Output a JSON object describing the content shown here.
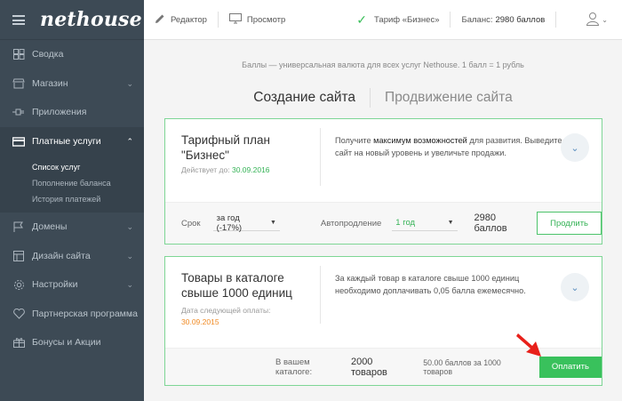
{
  "logo": "nethouse",
  "sidebar": {
    "items": [
      {
        "label": "Сводка",
        "icon": "squares-icon",
        "chevron": ""
      },
      {
        "label": "Магазин",
        "icon": "store-icon",
        "chevron": "⌄"
      },
      {
        "label": "Приложения",
        "icon": "plug-icon",
        "chevron": ""
      },
      {
        "label": "Платные услуги",
        "icon": "card-icon",
        "chevron": "⌃"
      }
    ],
    "sub_items": [
      "Список услуг",
      "Пополнение баланса",
      "История платежей"
    ],
    "items2": [
      {
        "label": "Домены",
        "icon": "flag-icon",
        "chevron": "⌄"
      },
      {
        "label": "Дизайн сайта",
        "icon": "layout-icon",
        "chevron": "⌄"
      },
      {
        "label": "Настройки",
        "icon": "gear-icon",
        "chevron": "⌄"
      },
      {
        "label": "Партнерская программа",
        "icon": "heart-icon",
        "chevron": "⌄"
      },
      {
        "label": "Бонусы и Акции",
        "icon": "gift-icon",
        "chevron": ""
      }
    ]
  },
  "topbar": {
    "editor": "Редактор",
    "preview": "Просмотр",
    "tariff": "Тариф «Бизнес»",
    "balance_label": "Баланс:",
    "balance_value": "2980 баллов"
  },
  "main": {
    "hint": "Баллы — универсальная валюта для всех услуг Nethouse. 1 балл = 1 рубль",
    "tabs": [
      "Создание сайта",
      "Продвижение сайта"
    ],
    "card1": {
      "title": "Тарифный план \"Бизнес\"",
      "valid_label": "Действует до:",
      "valid_date": "30.09.2016",
      "desc_pre": "Получите",
      "desc_bold": "максимум возможностей",
      "desc_post": "для развития. Выведите сайт на новый уровень и увеличьте продажи.",
      "term_label": "Срок",
      "term_value": "за год (-17%)",
      "renew_label": "Автопродление",
      "renew_value": "1 год",
      "price": "2980 баллов",
      "button": "Продлить"
    },
    "card2": {
      "title": "Товары в каталоге свыше 1000 единиц",
      "next_label": "Дата следующей оплаты:",
      "next_date": "30.09.2015",
      "desc": "За каждый товар в каталоге свыше 1000 единиц необходимо доплачивать 0,05 балла ежемесячно.",
      "catalog_label": "В вашем каталоге:",
      "catalog_value": "2000 товаров",
      "rate": "50.00 баллов за 1000 товаров",
      "button": "Оплатить"
    }
  },
  "colors": {
    "sidebar": "#3d4a55",
    "accent_green": "#39c15c",
    "arrow_red": "#e8201a"
  }
}
